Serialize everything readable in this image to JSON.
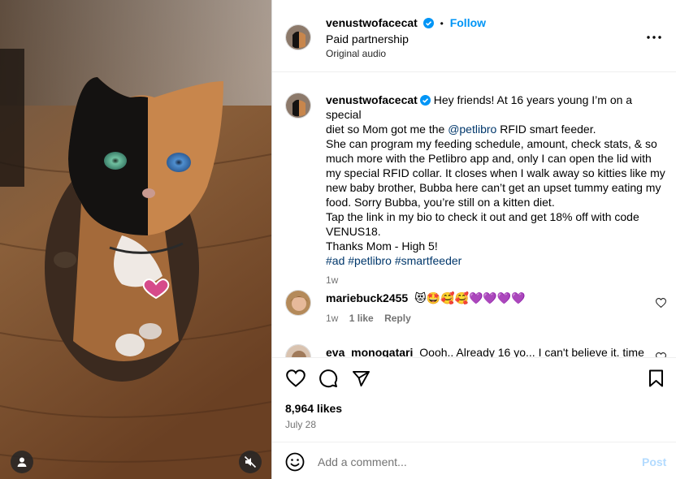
{
  "post": {
    "username": "venustwofacecat",
    "follow_label": "Follow",
    "separator": "•",
    "paid_partnership": "Paid partnership",
    "audio": "Original audio",
    "caption": {
      "intro": "Hey friends! At 16 years young I’m on a special",
      "line2_a": "diet so Mom got me the ",
      "mention": "@petlibro",
      "line2_b": " RFID smart feeder.",
      "line3": "She can program my feeding schedule, amount, check stats, & so",
      "line4": "much more with the Petlibro app and, only I can open the lid with",
      "line5": "my special RFID collar. It closes when I walk away so kitties like my",
      "line6": "new baby brother, Bubba here can’t get an upset tummy eating my",
      "line7": "food. Sorry Bubba, you’re still on a kitten diet.",
      "line8": "Tap the link in my bio to check it out and get 18% off with code",
      "line9": "VENUS18.",
      "line10": "Thanks Mom - High 5!",
      "tag1": "#ad",
      "tag2": "#petlibro",
      "tag3": "#smartfeeder",
      "time": "1w"
    }
  },
  "comments": [
    {
      "username": "mariebuck2455",
      "text": "😻🤩🥰🥰💜💜💜💜",
      "time": "1w",
      "likes": "1 like",
      "reply": "Reply"
    },
    {
      "username": "eva_monogatari",
      "text": "Oooh.. Already 16 yo... I can't believe it. time"
    }
  ],
  "footer": {
    "likes": "8,964 likes",
    "date": "July 28",
    "comment_placeholder": "Add a comment...",
    "post_label": "Post"
  },
  "colors": {
    "accent": "#0095f6",
    "link": "#00376b",
    "muted": "#737373"
  }
}
